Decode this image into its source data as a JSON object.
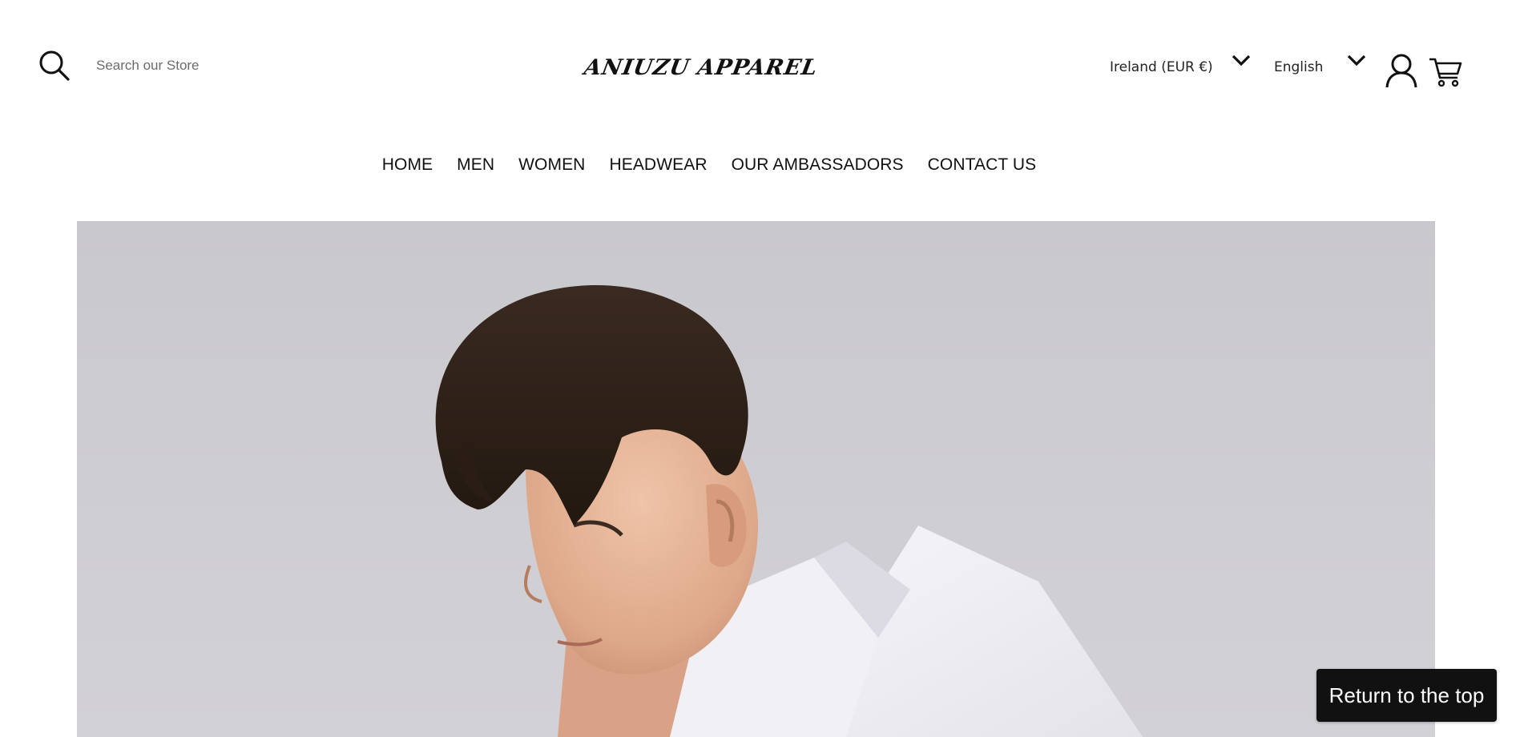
{
  "header": {
    "search": {
      "placeholder": "Search our Store",
      "icon": "search-icon"
    },
    "logo": "ANIUZU APPAREL",
    "country_selector": {
      "value": "Ireland (EUR €)",
      "icon": "chevron-down-icon"
    },
    "language_selector": {
      "value": "English",
      "icon": "chevron-down-icon"
    },
    "account_icon": "user-icon",
    "cart_icon": "cart-icon"
  },
  "nav": {
    "items": [
      {
        "label": "HOME"
      },
      {
        "label": "MEN"
      },
      {
        "label": "WOMEN"
      },
      {
        "label": "HEADWEAR"
      },
      {
        "label": "OUR AMBASSADORS"
      },
      {
        "label": "CONTACT US"
      }
    ]
  },
  "hero": {
    "background_color": "#cbcacf"
  },
  "return_top": {
    "label": "Return to the top"
  },
  "colors": {
    "text": "#111111",
    "button_bg": "#111111",
    "button_text": "#ffffff"
  }
}
